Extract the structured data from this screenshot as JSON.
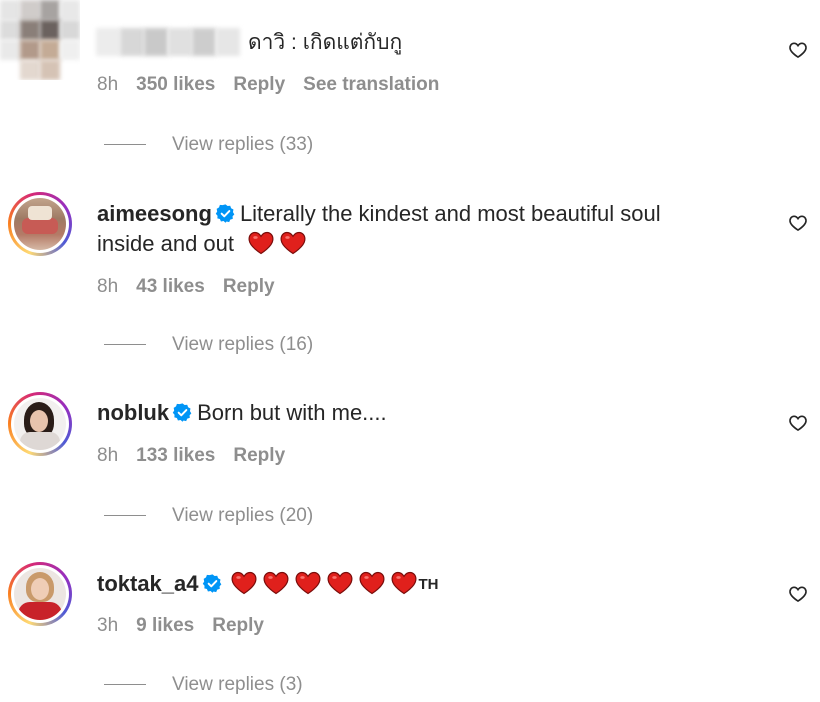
{
  "comments": [
    {
      "username": "",
      "text": "ดาวิ : เกิดแต่กับกู",
      "time": "8h",
      "likes": "350 likes",
      "reply": "Reply",
      "translate": "See translation",
      "view_replies": "View replies (33)"
    },
    {
      "username": "aimeesong",
      "text_line1": "Literally the kindest and most beautiful soul",
      "text_line2": "inside and out",
      "time": "8h",
      "likes": "43 likes",
      "reply": "Reply",
      "view_replies": "View replies (16)"
    },
    {
      "username": "nobluk",
      "text": "Born but with me....",
      "time": "8h",
      "likes": "133 likes",
      "reply": "Reply",
      "view_replies": "View replies (20)"
    },
    {
      "username": "toktak_a4",
      "text_suffix": "TH",
      "time": "3h",
      "likes": "9 likes",
      "reply": "Reply",
      "view_replies": "View replies (3)"
    }
  ],
  "icons": {
    "like": "heart-outline-icon",
    "verified": "verified-badge-icon",
    "emoji": "red-heart-emoji"
  },
  "colors": {
    "text": "#262626",
    "meta": "#8e8e8e",
    "verified": "#0095f6",
    "heart_emoji": "#e0201c"
  }
}
